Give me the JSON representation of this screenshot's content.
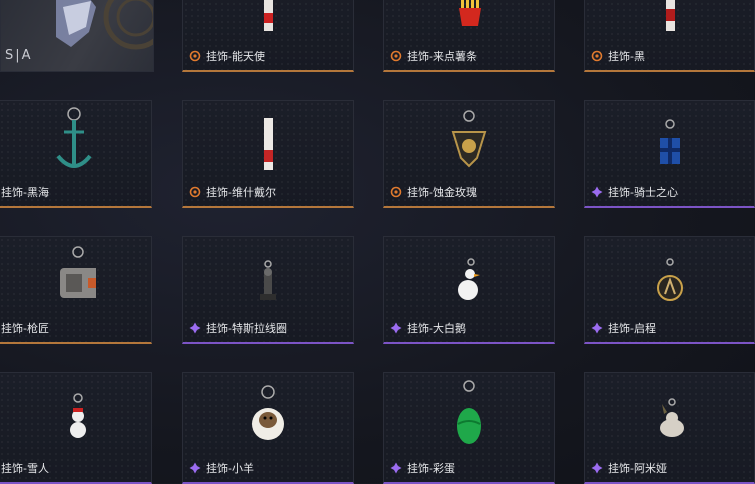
{
  "hero": {
    "text": "S|A"
  },
  "colors": {
    "gold_rarity": "#e07a2e",
    "purple_rarity": "#9b6cf0",
    "label": "#e6e7ea"
  },
  "items": [
    {
      "label": "挂饰-能天使",
      "rarity": "gold",
      "icon": "red-white-ribbon-tag"
    },
    {
      "label": "挂饰-来点薯条",
      "rarity": "gold",
      "icon": "french-fries"
    },
    {
      "label": "挂饰-黑",
      "rarity": "gold",
      "icon": "black-red-ribbon-tag"
    },
    {
      "label": "挂饰-黑海",
      "rarity": "gold",
      "icon": "teal-anchor"
    },
    {
      "label": "挂饰-维什戴尔",
      "rarity": "gold",
      "icon": "red-white-ribbon-tag"
    },
    {
      "label": "挂饰-蚀金玫瑰",
      "rarity": "gold",
      "icon": "gold-rose-emblem"
    },
    {
      "label": "挂饰-骑士之心",
      "rarity": "purple",
      "icon": "blue-knight-shield"
    },
    {
      "label": "挂饰-枪匠",
      "rarity": "gold",
      "icon": "gunsmith-toolbox"
    },
    {
      "label": "挂饰-特斯拉线圈",
      "rarity": "purple",
      "icon": "tesla-coil"
    },
    {
      "label": "挂饰-大白鹅",
      "rarity": "purple",
      "icon": "white-goose"
    },
    {
      "label": "挂饰-启程",
      "rarity": "purple",
      "icon": "compass-medal"
    },
    {
      "label": "挂饰-雪人",
      "rarity": "purple",
      "icon": "snowman"
    },
    {
      "label": "挂饰-小羊",
      "rarity": "purple",
      "icon": "little-sheep"
    },
    {
      "label": "挂饰-彩蛋",
      "rarity": "purple",
      "icon": "green-easter-egg"
    },
    {
      "label": "挂饰-阿米娅",
      "rarity": "purple",
      "icon": "amiya-figurine"
    }
  ]
}
